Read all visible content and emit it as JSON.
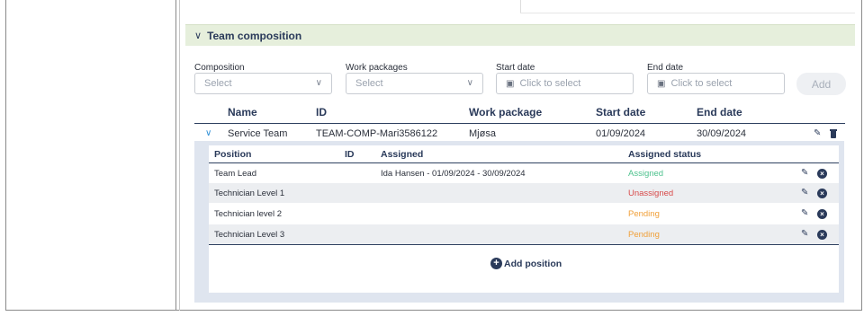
{
  "section": {
    "title": "Team composition",
    "chevron_icon": "chevron-down-icon"
  },
  "filters": {
    "composition": {
      "label": "Composition",
      "placeholder": "Select"
    },
    "work_packages": {
      "label": "Work packages",
      "placeholder": "Select"
    },
    "start_date": {
      "label": "Start date",
      "placeholder": "Click to select"
    },
    "end_date": {
      "label": "End date",
      "placeholder": "Click to select"
    },
    "add_label": "Add"
  },
  "table": {
    "headers": [
      "Name",
      "ID",
      "Work package",
      "Start date",
      "End date"
    ],
    "rows": [
      {
        "name": "Service Team",
        "id": "TEAM-COMP-Mari3586122",
        "work_package": "Mjøsa",
        "start": "01/09/2024",
        "end": "30/09/2024"
      }
    ]
  },
  "positions": {
    "headers": [
      "Position",
      "ID",
      "Assigned",
      "Assigned status"
    ],
    "rows": [
      {
        "position": "Team Lead",
        "id": "",
        "assigned": "Ida Hansen - 01/09/2024 - 30/09/2024",
        "status": "Assigned"
      },
      {
        "position": "Technician Level 1",
        "id": "",
        "assigned": "",
        "status": "Unassigned"
      },
      {
        "position": "Technician level 2",
        "id": "",
        "assigned": "",
        "status": "Pending"
      },
      {
        "position": "Technician Level 3",
        "id": "",
        "assigned": "",
        "status": "Pending"
      }
    ],
    "add_label": "Add position"
  },
  "colors": {
    "assigned": "#4ec28e",
    "unassigned": "#d84a4a",
    "pending": "#f0a03a",
    "accent": "#2a3a5a"
  }
}
